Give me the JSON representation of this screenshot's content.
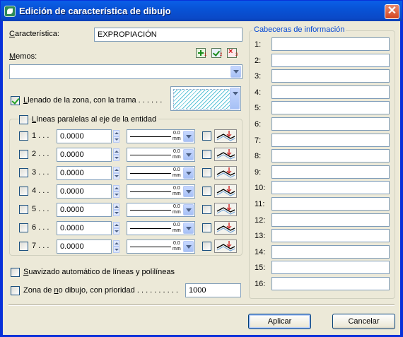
{
  "window": {
    "title": "Edición de característica de dibujo",
    "close_glyph": "✕"
  },
  "caracteristica": {
    "label_u": "C",
    "label_rest": "aracterística:",
    "value": "EXPROPIACIÓN"
  },
  "memos": {
    "label_u": "M",
    "label_rest": "emos:",
    "icons": [
      "add-memo-icon",
      "edit-memo-icon",
      "delete-memo-icon"
    ],
    "icon_subs": [
      "1",
      "2",
      "3"
    ],
    "value": ""
  },
  "llenado": {
    "checked": true,
    "label_u": "L",
    "label_rest": "lenado de la zona, con la trama . . . . . ."
  },
  "lineas": {
    "label_u": "L",
    "label_rest": "íneas paralelas al eje de la entidad",
    "rows": [
      {
        "label": "1 . . .",
        "value": "0.0000",
        "lw_top": "0.0",
        "lw_unit": "mm"
      },
      {
        "label": "2 . . .",
        "value": "0.0000",
        "lw_top": "0.0",
        "lw_unit": "mm"
      },
      {
        "label": "3 . . .",
        "value": "0.0000",
        "lw_top": "0.0",
        "lw_unit": "mm"
      },
      {
        "label": "4 . . .",
        "value": "0.0000",
        "lw_top": "0.0",
        "lw_unit": "mm"
      },
      {
        "label": "5 . . .",
        "value": "0.0000",
        "lw_top": "0.0",
        "lw_unit": "mm"
      },
      {
        "label": "6 . . .",
        "value": "0.0000",
        "lw_top": "0.0",
        "lw_unit": "mm"
      },
      {
        "label": "7 . . .",
        "value": "0.0000",
        "lw_top": "0.0",
        "lw_unit": "mm"
      }
    ]
  },
  "suavizado": {
    "label_u": "S",
    "label_rest": "uavizado automático de líneas y polilíneas"
  },
  "zona": {
    "label_pre": "Zona de ",
    "label_u": "n",
    "label_rest": "o dibujo, con prioridad . . . . . . . . . .",
    "value": "1000"
  },
  "cabeceras": {
    "title": "Cabeceras de información",
    "rows": [
      "1:",
      "2:",
      "3:",
      "4:",
      "5:",
      "6:",
      "7:",
      "8:",
      "9:",
      "10:",
      "11:",
      "12:",
      "13:",
      "14:",
      "15:",
      "16:"
    ]
  },
  "buttons": {
    "apply": "Aplicar",
    "cancel": "Cancelar"
  }
}
